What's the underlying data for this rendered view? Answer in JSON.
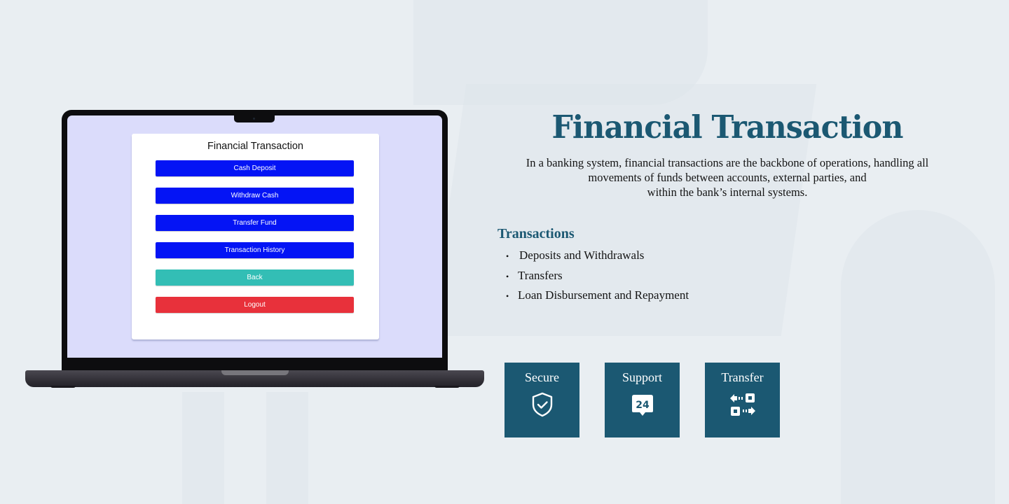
{
  "laptop_app": {
    "title": "Financial Transaction",
    "buttons": [
      {
        "label": "Cash Deposit",
        "color": "#0414f5"
      },
      {
        "label": "Withdraw Cash",
        "color": "#0414f5"
      },
      {
        "label": "Transfer Fund",
        "color": "#0414f5"
      },
      {
        "label": "Transaction History",
        "color": "#0414f5"
      },
      {
        "label": "Back",
        "color": "#33beb5"
      },
      {
        "label": "Logout",
        "color": "#e8313b"
      }
    ]
  },
  "hero": {
    "title": "Financial Transaction",
    "description_lines": [
      "In a banking system, financial transactions are the backbone of operations, handling all",
      "movements of funds between accounts, external parties, and",
      "within the bank’s internal systems."
    ]
  },
  "transactions": {
    "heading": "Transactions",
    "items": [
      "Deposits and Withdrawals",
      "Transfers",
      "Loan Disbursement and Repayment"
    ]
  },
  "features": [
    {
      "label": "Secure",
      "icon": "shield-check-icon"
    },
    {
      "label": "Support",
      "icon": "support-24-icon"
    },
    {
      "label": "Transfer",
      "icon": "transfer-arrows-icon"
    }
  ],
  "colors": {
    "brand": "#1b5872",
    "background": "#e9eef2",
    "screen": "#dbdcfb"
  }
}
